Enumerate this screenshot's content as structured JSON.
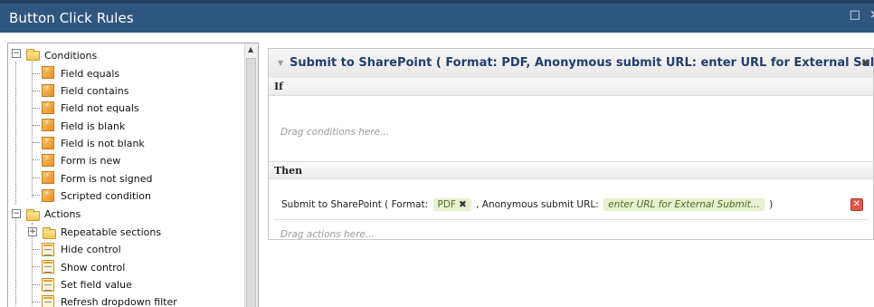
{
  "window": {
    "title": "Button Click Rules",
    "buttons": [
      "□",
      "×"
    ]
  },
  "tree": {
    "conditions": {
      "label": "Conditions",
      "items": [
        "Field equals",
        "Field contains",
        "Field not equals",
        "Field is blank",
        "Field is not blank",
        "Form is new",
        "Form is not signed",
        "Scripted condition"
      ]
    },
    "actions": {
      "label": "Actions",
      "folder": "Repeatable sections",
      "items": [
        "Hide control",
        "Show control",
        "Set field value",
        "Refresh dropdown filter"
      ]
    }
  },
  "rule": {
    "title": "Submit to SharePoint ( Format: PDF, Anonymous submit URL: enter URL for External Submit... )",
    "if_label": "If",
    "conditions_hint": "Drag conditions here...",
    "then_label": "Then",
    "action": {
      "prefix": "Submit to SharePoint ( Format:",
      "format_value": "PDF",
      "format_remove": "✖",
      "url_label": ", Anonymous submit URL:",
      "url_value": "enter URL for External Submit...",
      "suffix": ")"
    },
    "actions_hint": "Drag actions here..."
  }
}
